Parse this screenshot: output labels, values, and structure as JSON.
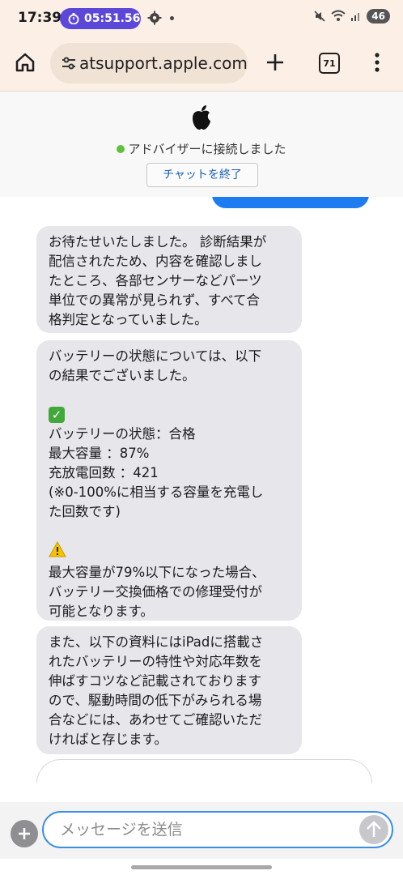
{
  "status_bar": {
    "time": "17:39",
    "timer": "05:51.56",
    "battery": "46"
  },
  "browser": {
    "url": "atsupport.apple.com",
    "tab_count": "71"
  },
  "chat_header": {
    "status_text": "アドバイザーに接続しました",
    "end_chat_label": "チャットを終了",
    "status_color": "#5ec13a"
  },
  "messages": [
    {
      "lines": [
        "お待たせいたしました。 診断結果が",
        "配信されたため、内容を確認しまし",
        "たところ、各部センサーなどパーツ",
        "単位での異常が見られず、すべて合",
        "格判定となっていました。"
      ]
    },
    {
      "intro": [
        "バッテリーの状態については、以下",
        "の結果でございました。"
      ],
      "check_icon": "check-mark-icon",
      "details": [
        "バッテリーの状態：合格",
        "最大容量 ：87%",
        "充放電回数 ：421",
        "(※0-100%に相当する容量を充電し",
        "た回数です)"
      ],
      "warning_icon": "warning-icon",
      "warning": [
        "最大容量が79%以下になった場合、",
        "バッテリー交換価格での修理受付が",
        "可能となります。"
      ]
    },
    {
      "lines": [
        "また、以下の資料にはiPadに搭載さ",
        "れたバッテリーの特性や対応年数を",
        "伸ばすコツなど記載されております",
        "ので、駆動時間の低下がみられる場",
        "合などには、あわせてご確認いただ",
        "ければと存じます。"
      ]
    }
  ],
  "input": {
    "placeholder": "メッセージを送信",
    "value": ""
  },
  "colors": {
    "accent": "#1c7cf0",
    "bubble_bg": "#e6e6eb",
    "timer_bg": "#5b48d8"
  }
}
